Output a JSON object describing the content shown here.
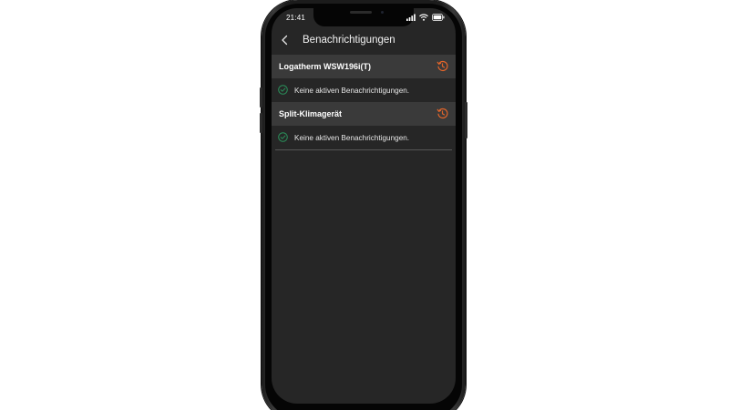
{
  "status_bar": {
    "time": "21:41"
  },
  "header": {
    "title": "Benachrichtigungen"
  },
  "devices": [
    {
      "name": "Logatherm WSW196i(T)",
      "notification_text": "Keine aktiven Benachrichtigungen."
    },
    {
      "name": "Split-Klimagerät",
      "notification_text": "Keine aktiven Benachrichtigungen."
    }
  ],
  "colors": {
    "screen_background": "#262626",
    "section_header": "#3a3a3a",
    "accent_orange": "#e2652a",
    "check_green": "#2a8f5a",
    "text_primary": "#ffffff"
  },
  "icons": {
    "back": "chevron-left-icon",
    "history": "history-clock-icon",
    "check": "check-circle-icon",
    "signal": "cellular-signal-icon",
    "wifi": "wifi-icon",
    "battery": "battery-icon"
  }
}
